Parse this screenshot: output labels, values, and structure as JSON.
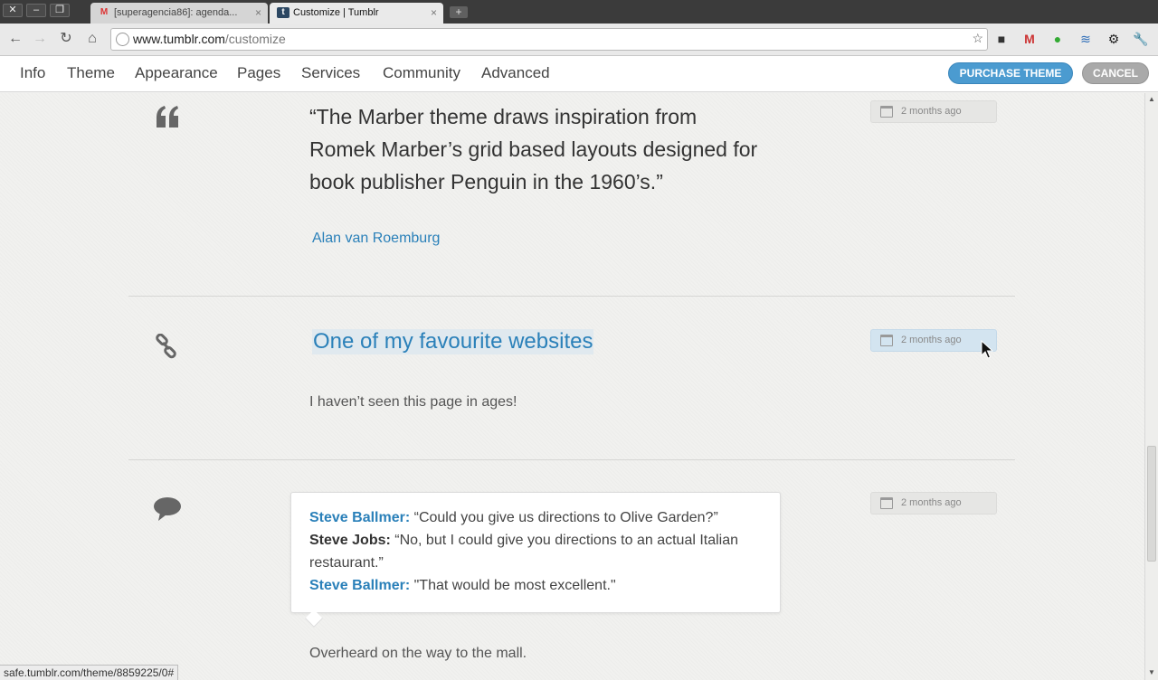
{
  "browser": {
    "tabs": [
      {
        "label": "[superagencia86]: agenda..."
      },
      {
        "label": "Customize | Tumblr"
      }
    ],
    "url_host": "www.tumblr.com",
    "url_path": "/customize",
    "status_url": "safe.tumblr.com/theme/8859225/0#"
  },
  "header": {
    "menu": [
      "Info",
      "Theme",
      "Appearance",
      "Pages",
      "Services",
      "Community",
      "Advanced"
    ],
    "purchase_label": "PURCHASE THEME",
    "cancel_label": "CANCEL",
    "colors": {
      "purchase": "#4b9bd0",
      "cancel": "#a9a9a9",
      "link": "#2a80b9"
    }
  },
  "posts": {
    "quote": {
      "text": "“The Marber theme draws inspiration from Romek Marber’s grid based layouts designed for book publisher Penguin in the 1960’s.”",
      "source": "Alan van Roemburg",
      "date": "2 months ago",
      "icon": "quote-icon"
    },
    "link": {
      "title": "One of my favourite websites",
      "description": "I haven’t seen this page in ages!",
      "date": "2 months ago",
      "icon": "link-icon"
    },
    "chat": {
      "lines": [
        {
          "speaker": "Steve Ballmer:",
          "text": " “Could you give us directions to Olive Garden?”"
        },
        {
          "speaker": "Steve Jobs:",
          "text": " “No, but I could give you directions to an actual Italian restaurant.”"
        },
        {
          "speaker": "Steve Ballmer:",
          "text": " \"That would be most excellent.\""
        }
      ],
      "caption": "Overheard on the way to the mall.",
      "date": "2 months ago",
      "icon": "speech-bubble-icon"
    }
  }
}
